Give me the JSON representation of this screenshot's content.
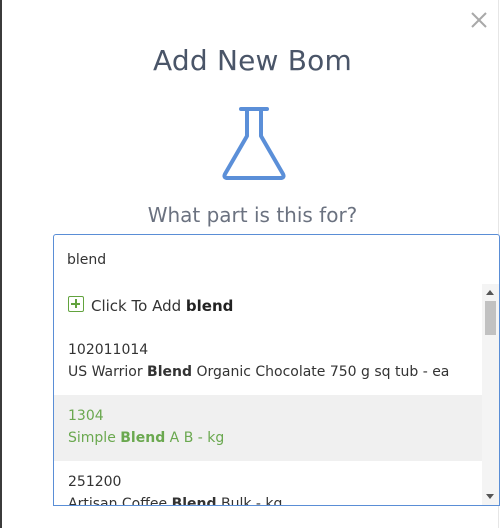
{
  "modal": {
    "title": "Add New Bom",
    "question": "What part is this for?"
  },
  "search": {
    "value": "blend",
    "placeholder": ""
  },
  "dropdown": {
    "add_prefix": "Click To Add",
    "add_term": "blend",
    "items": [
      {
        "code": "102011014",
        "desc_before": "US Warrior ",
        "desc_match": "Blend",
        "desc_after": " Organic Chocolate 750 g sq tub - ea",
        "highlighted": false
      },
      {
        "code": "1304",
        "desc_before": "Simple ",
        "desc_match": "Blend",
        "desc_after": " A B - kg",
        "highlighted": true
      },
      {
        "code": "251200",
        "desc_before": "Artisan Coffee ",
        "desc_match": "Blend",
        "desc_after": " Bulk - kg",
        "highlighted": false
      }
    ]
  },
  "colors": {
    "accent_blue": "#5a8ed6",
    "highlight_green": "#6aa84f",
    "title_gray": "#4a5568"
  },
  "icons": {
    "close": "close-icon",
    "flask": "flask-icon",
    "add": "plus-square-icon"
  }
}
